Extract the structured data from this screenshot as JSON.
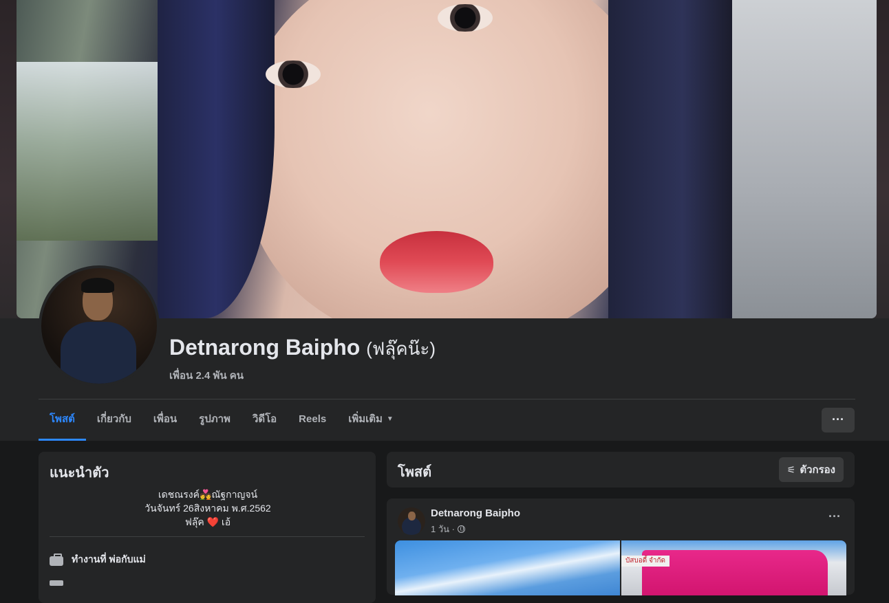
{
  "profile": {
    "name": "Detnarong Baipho",
    "alt_name": "(ฟลุ๊คน๊ะ)",
    "friends": "เพื่อน 2.4 พัน คน"
  },
  "tabs": [
    {
      "label": "โพสต์",
      "active": true
    },
    {
      "label": "เกี่ยวกับ",
      "active": false
    },
    {
      "label": "เพื่อน",
      "active": false
    },
    {
      "label": "รูปภาพ",
      "active": false
    },
    {
      "label": "วิดีโอ",
      "active": false
    },
    {
      "label": "Reels",
      "active": false
    },
    {
      "label": "เพิ่มเติม",
      "active": false
    }
  ],
  "more_button": "···",
  "intro": {
    "title": "แนะนำตัว",
    "bio": [
      "เดชณรงค์💑ณัฐกาญจน์",
      "วันจันทร์ 26สิงหาคม พ.ศ.2562",
      "ฟลุ๊ค ❤️ เอ้"
    ],
    "work": "ทำงานที่ พ่อกับแม่"
  },
  "posts": {
    "title": "โพสต์",
    "filter_label": "ตัวกรอง",
    "items": [
      {
        "author": "Detnarong Baipho",
        "time": "1 วัน ·",
        "photo_sign": "บัสบอดี้ จำกัด"
      }
    ]
  },
  "colors": {
    "accent": "#2d88ff",
    "card_bg": "#242526",
    "page_bg": "#18191a",
    "button_bg": "#3a3b3c"
  },
  "icons": [
    "briefcase-icon",
    "globe-icon",
    "filter-icon",
    "chevron-down-icon",
    "more-icon"
  ]
}
